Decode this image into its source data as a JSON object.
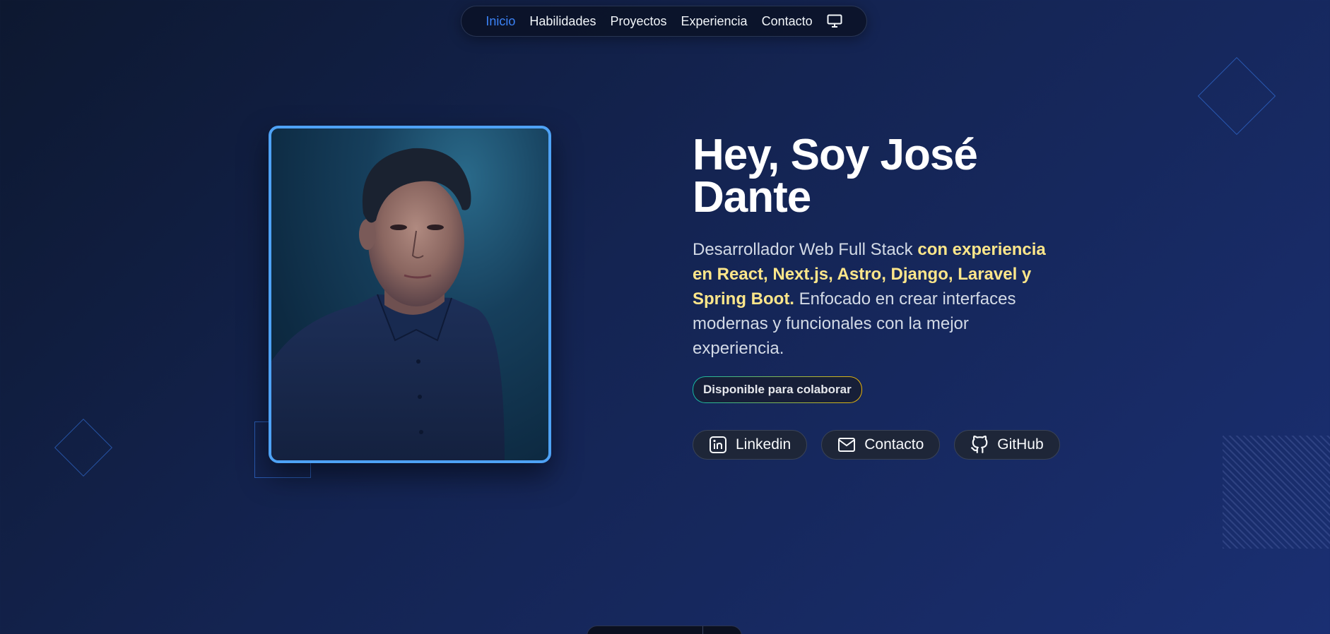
{
  "nav": {
    "items": [
      {
        "label": "Inicio",
        "active": true
      },
      {
        "label": "Habilidades",
        "active": false
      },
      {
        "label": "Proyectos",
        "active": false
      },
      {
        "label": "Experiencia",
        "active": false
      },
      {
        "label": "Contacto",
        "active": false
      }
    ],
    "theme_icon": "monitor-icon"
  },
  "hero": {
    "title": "Hey, Soy José Dante",
    "desc_start": "Desarrollador Web Full Stack ",
    "desc_highlight": "con experiencia en React, Next.js, Astro, Django, Laravel y Spring Boot.",
    "desc_end": " Enfocado en crear interfaces modernas y funcionales con la mejor experiencia.",
    "badge": "Disponible para colaborar",
    "photo_alt": "portrait",
    "links": [
      {
        "label": "Linkedin",
        "icon": "linkedin-icon"
      },
      {
        "label": "Contacto",
        "icon": "mail-icon"
      },
      {
        "label": "GitHub",
        "icon": "github-icon"
      }
    ]
  },
  "colors": {
    "accent": "#3b82f6",
    "highlight": "#fde68a",
    "photo_border": "#4ea2f5"
  }
}
